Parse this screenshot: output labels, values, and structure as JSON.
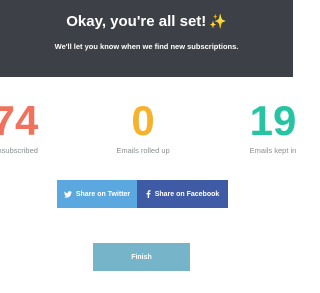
{
  "header": {
    "title": "Okay, you're all set!",
    "title_emoji": "✨",
    "subtitle": "We'll let you know when we find new subscriptions."
  },
  "stats": [
    {
      "value": "74",
      "label": "Unsubscribed",
      "color": "#f0725c"
    },
    {
      "value": "0",
      "label": "Emails rolled up",
      "color": "#f6b22d"
    },
    {
      "value": "19",
      "label": "Emails kept in",
      "color": "#27c4a3"
    }
  ],
  "share": {
    "twitter_label": "Share on Twitter",
    "twitter_icon": "twitter-bird-icon",
    "facebook_label": "Share on Facebook",
    "facebook_icon": "facebook-f-icon"
  },
  "finish_label": "Finish"
}
